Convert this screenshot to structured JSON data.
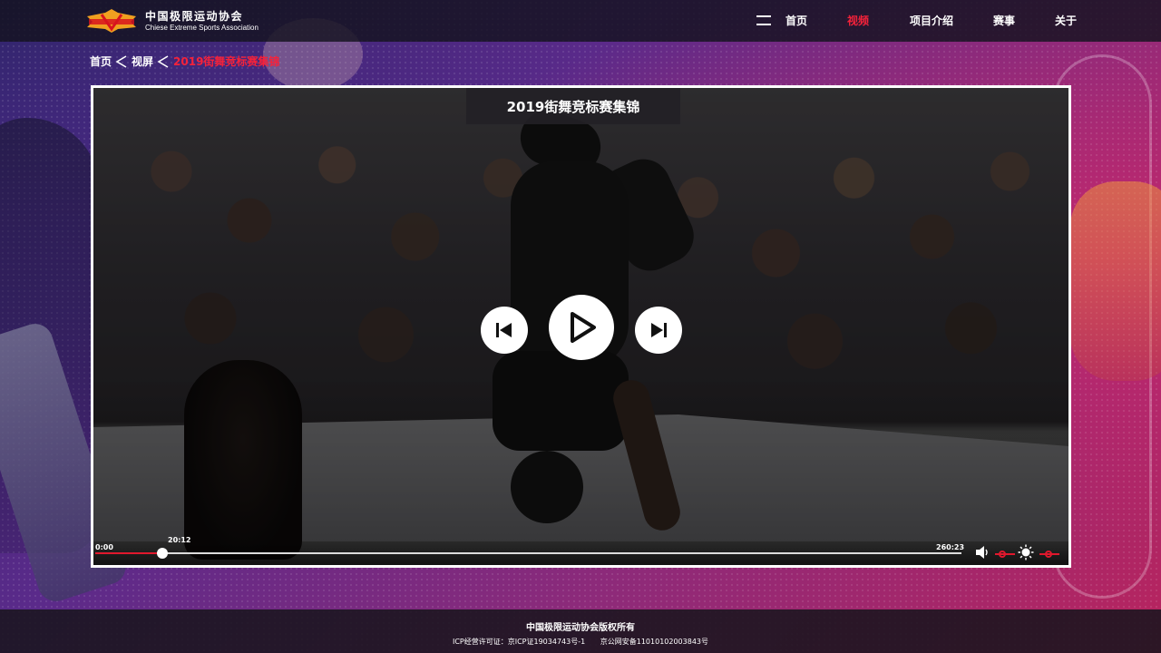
{
  "header": {
    "logo_cn": "中国极限运动协会",
    "logo_en": "Chiese Extreme Sports Association",
    "nav": [
      {
        "label": "首页",
        "active": false
      },
      {
        "label": "视频",
        "active": true
      },
      {
        "label": "项目介绍",
        "active": false
      },
      {
        "label": "赛事",
        "active": false
      },
      {
        "label": "关于",
        "active": false
      }
    ]
  },
  "breadcrumb": {
    "home": "首页",
    "section": "视屏",
    "current": "2019街舞竞标赛集锦"
  },
  "player": {
    "title": "2019街舞竞标赛集锦",
    "time_start": "0:00",
    "time_current": "20:12",
    "time_total": "260:23",
    "progress": 0.0776,
    "volume": 0.4,
    "brightness": 0.5,
    "icons": [
      "skip-previous-icon",
      "play-icon",
      "skip-next-icon",
      "volume-icon",
      "brightness-icon"
    ]
  },
  "footer": {
    "copyright": "中国极限运动协会版权所有",
    "icp_license": "ICP经营许可证：京ICP证19034743号-1",
    "public_security": "京公网安备11010102003843号"
  },
  "colors": {
    "accent": "#f5223a",
    "progress": "#e0182d",
    "header_bg": "#14121e"
  }
}
